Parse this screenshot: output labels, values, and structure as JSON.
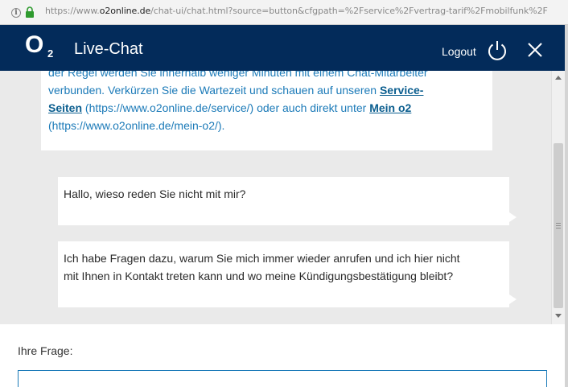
{
  "browser": {
    "url_prefix": "https://www.",
    "url_domain": "o2online.de",
    "url_rest": "/chat-ui/chat.html?source=button&cfgpath=%2Fservice%2Fvertrag-tarif%2Fmobilfunk%2F"
  },
  "header": {
    "logo": "O",
    "logo_sub": "2",
    "title": "Live-Chat",
    "logout_label": "Logout"
  },
  "messages": {
    "agent": {
      "line1": "der Regel werden Sie innerhalb weniger Minuten mit einem Chat-Mitarbeiter",
      "line2": "verbunden. Verkürzen Sie die Wartezeit und schauen auf unseren",
      "link1_a": "Service-",
      "link1_b": "Seiten",
      "line3": "(https://www.o2online.de/service/) oder auch direkt unter",
      "link2": "Mein o2",
      "line4": "(https://www.o2online.de/mein-o2/)."
    },
    "user1": "Hallo, wieso reden Sie nicht mit mir?",
    "user2_line1": "Ich habe Fragen dazu, warum Sie mich immer wieder anrufen und ich hier nicht",
    "user2_line2": "mit Ihnen in Kontakt treten kann und wo meine Kündigungsbestätigung bleibt?"
  },
  "input": {
    "label": "Ihre Frage:",
    "value": "",
    "placeholder": ""
  },
  "colors": {
    "header_bg": "#032b5a",
    "chat_bg": "#eaeaea",
    "agent_text": "#1b7ab8",
    "link": "#0b5e8f"
  },
  "icons": [
    "info-icon",
    "lock-icon",
    "power-icon",
    "close-icon"
  ]
}
